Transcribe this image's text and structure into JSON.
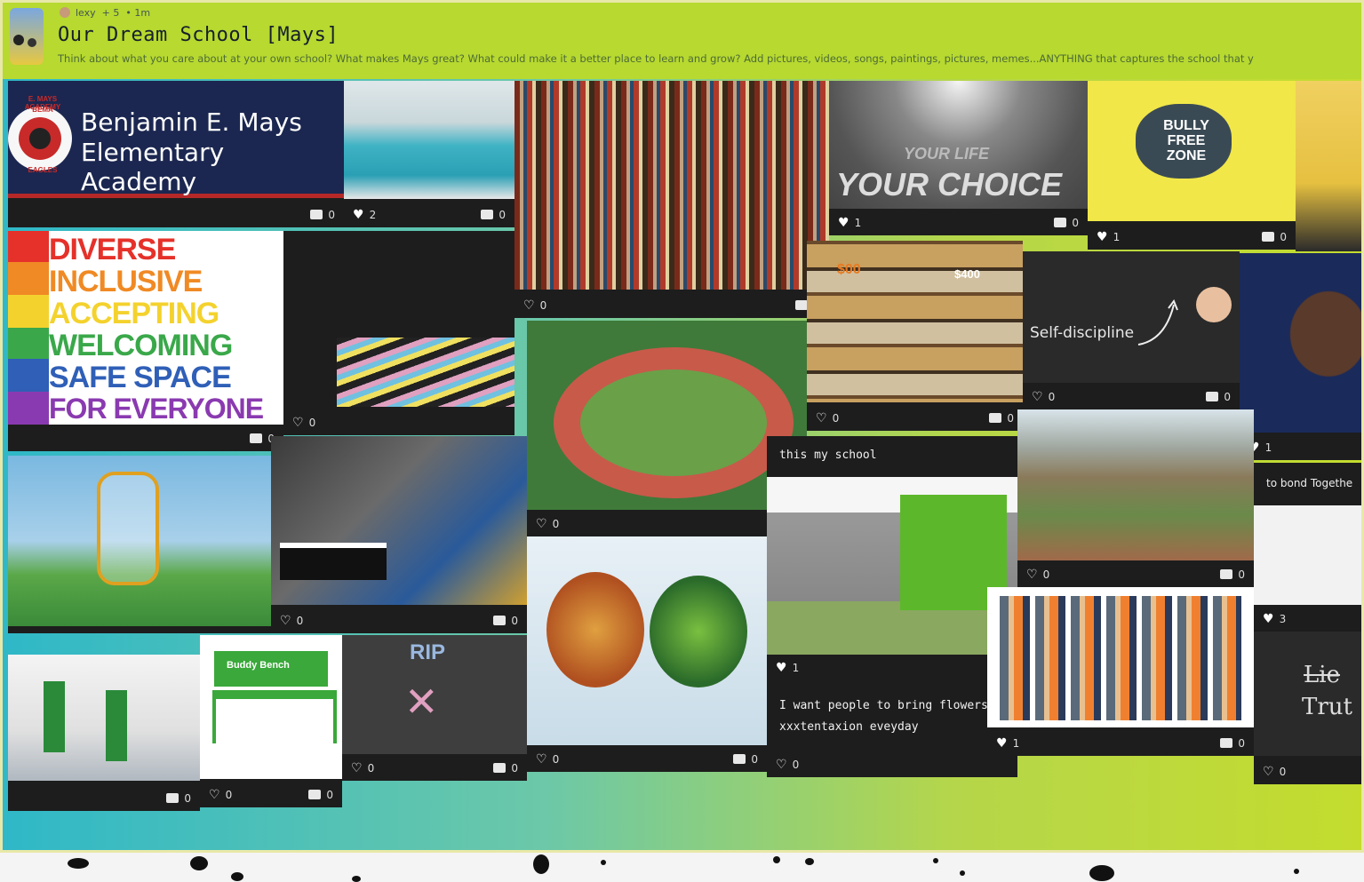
{
  "header": {
    "author": "lexy",
    "collaborators": "+ 5",
    "age": "1m",
    "title": "Our Dream School [Mays]",
    "description": "Think about what you care about at your own school? What makes Mays great? What could make it a better place to learn and grow? Add pictures, videos, songs, paintings, pictures, memes...ANYTHING that captures the school that y"
  },
  "colors": {
    "header_bg": "#b7d930",
    "card_bg": "#1d1d1d"
  },
  "cards": {
    "mays_sign": {
      "line1": "Benjamin E. Mays",
      "line2": "Elementary Academy",
      "seal_top": "E. MAYS ACADEMY",
      "seal_mid": "BEMA",
      "seal_bot": "EAGLES",
      "likes": "",
      "comments": "0"
    },
    "pool": {
      "likes": "2",
      "comments": "0"
    },
    "library": {
      "likes": "0",
      "comments": "0"
    },
    "your_life": {
      "text1": "YOUR LIFE",
      "text2": "YOUR CHOICE",
      "likes": "1",
      "comments": "0"
    },
    "bully_free": {
      "text": "BULLY FREE ZONE",
      "likes": "1",
      "comments": "0"
    },
    "diverse": {
      "lines": [
        "DIVERSE",
        "INCLUSIVE",
        "ACCEPTING",
        "WELCOMING",
        "SAFE SPACE",
        "FOR EVERYONE"
      ],
      "comments": "0"
    },
    "classroom": {
      "likes": "0",
      "comments": ""
    },
    "store": {
      "price1": "$00",
      "price2": "$400",
      "likes": "0",
      "comments": "0"
    },
    "self_discipline": {
      "text": "Self-discipline",
      "likes": "0",
      "comments": "0"
    },
    "xxx": {
      "likes": "1"
    },
    "track": {
      "likes": "0"
    },
    "this_school": {
      "caption": "this my school"
    },
    "city": {
      "likes": "0",
      "comments": "0"
    },
    "bond": {
      "caption": "to bond Togethe",
      "likes": "3"
    },
    "playground": {
      "likes": "0",
      "comments": "0"
    },
    "music_room": {
      "likes": "0",
      "comments": "0"
    },
    "food": {
      "likes": "0",
      "comments": "0"
    },
    "building": {
      "likes": "1",
      "caption1": "I want people to bring flowers",
      "caption2": "xxxtentaxion eveyday",
      "likes2": "0",
      "comments": "0"
    },
    "naruto": {
      "likes": "1",
      "comments": "0"
    },
    "lie_truth": {
      "text1": "Lie",
      "text2": "Trut",
      "likes": "0"
    },
    "cleaning": {
      "comments": "0"
    },
    "buddy_bench": {
      "sign": "Buddy Bench",
      "likes": "0",
      "comments": "0"
    },
    "chalk": {
      "text": "RIP",
      "likes": "0",
      "comments": "0"
    }
  }
}
